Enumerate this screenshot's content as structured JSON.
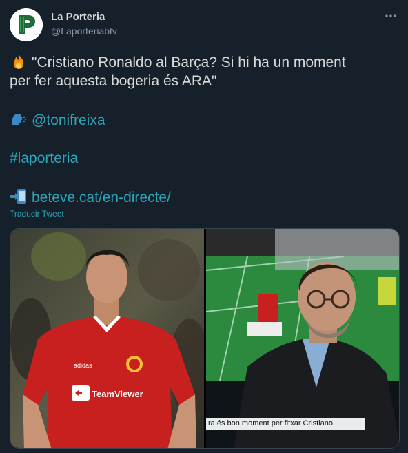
{
  "account": {
    "display_name": "La Porteria",
    "handle": "@Laporteriabtv",
    "avatar_letter": "P"
  },
  "tweet": {
    "quote_line1": "\"Cristiano Ronaldo al Barça? Si hi ha un moment",
    "quote_line2": "per fer aquesta bogeria és ARA\"",
    "mention": "@tonifreixa",
    "hashtag": "#laporteria",
    "url": "beteve.cat/en-directe/",
    "translate_label": "Traducir Tweet"
  },
  "media": {
    "left_photo": {
      "sponsor": "TeamViewer",
      "kit_brand": "adidas"
    },
    "right_photo": {
      "lower_third": "ra és bon moment per fitxar Cristiano"
    }
  },
  "icons": {
    "fire": "fire-emoji-icon",
    "speaking": "speaking-head-emoji-icon",
    "arrow_phone": "mobile-arrow-emoji-icon",
    "more": "more-options-icon"
  },
  "colors": {
    "background": "#15202b",
    "text": "#d9d9d9",
    "secondary": "#8b98a5",
    "link": "#2fa3b8",
    "avatar_green": "#1f6b3a"
  }
}
